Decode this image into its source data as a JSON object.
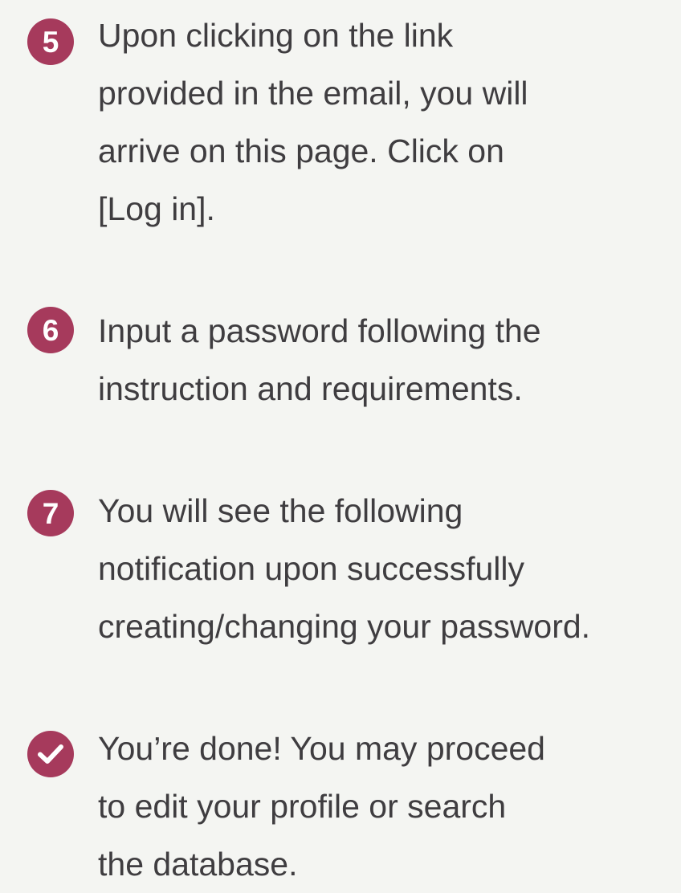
{
  "steps": [
    {
      "badge": "5",
      "text": "Upon clicking on the link\nprovided in the email, you will\narrive on this page. Click on\n[Log in]."
    },
    {
      "badge": "6",
      "text": "Input a password following the\ninstruction and requirements."
    },
    {
      "badge": "7",
      "text": "You will see the following\nnotification upon successfully\ncreating/changing your password."
    }
  ],
  "final_step": {
    "icon": "checkmark-icon",
    "text": "You’re done! You may proceed\nto edit your profile or search\nthe database."
  },
  "colors": {
    "badge": "#a63a5c",
    "text": "#3f3d40",
    "background": "#f4f5f2"
  }
}
